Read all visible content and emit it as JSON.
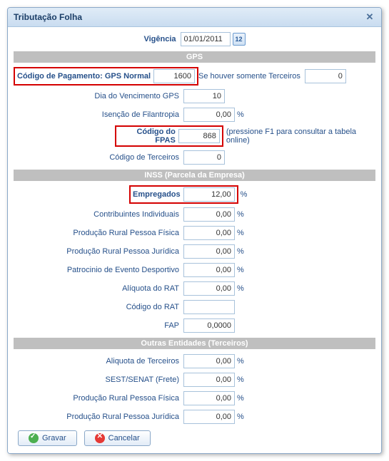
{
  "window": {
    "title": "Tributação Folha",
    "close": "✕"
  },
  "header": {
    "vigencia_label": "Vigência",
    "vigencia_value": "01/01/2011",
    "cal_text": "12"
  },
  "sections": {
    "gps": "GPS",
    "inss": "INSS (Parcela da Empresa)",
    "outras": "Outras Entidades (Terceiros)"
  },
  "gps": {
    "cod_pag_label": "Código de Pagamento: GPS Normal",
    "cod_pag_value": "1600",
    "terc_label": "Se houver somente Terceiros",
    "terc_value": "0",
    "dia_venc_label": "Dia do Vencimento GPS",
    "dia_venc_value": "10",
    "isencao_label": "Isenção de Filantropia",
    "isencao_value": "0,00",
    "fpas_label": "Código do FPAS",
    "fpas_value": "868",
    "fpas_hint": "(pressione F1 para consultar a tabela online)",
    "cod_terc_label": "Código de Terceiros",
    "cod_terc_value": "0"
  },
  "inss": {
    "empregados_label": "Empregados",
    "empregados_value": "12,00",
    "contrib_label": "Contribuintes Individuais",
    "contrib_value": "0,00",
    "prpf_label": "Produção Rural Pessoa Física",
    "prpf_value": "0,00",
    "prpj_label": "Produção Rural Pessoa Jurídica",
    "prpj_value": "0,00",
    "patro_label": "Patrocinio de Evento Desportivo",
    "patro_value": "0,00",
    "aliq_rat_label": "Alíquota do RAT",
    "aliq_rat_value": "0,00",
    "cod_rat_label": "Código do RAT",
    "cod_rat_value": "",
    "fap_label": "FAP",
    "fap_value": "0,0000"
  },
  "outras": {
    "aliq_terc_label": "Aliquota de Terceiros",
    "aliq_terc_value": "0,00",
    "sest_label": "SEST/SENAT (Frete)",
    "sest_value": "0,00",
    "prpf_label": "Produção Rural Pessoa Física",
    "prpf_value": "0,00",
    "prpj_label": "Produção Rural Pessoa Jurídica",
    "prpj_value": "0,00"
  },
  "buttons": {
    "gravar": "Gravar",
    "cancelar": "Cancelar"
  },
  "pct": "%"
}
